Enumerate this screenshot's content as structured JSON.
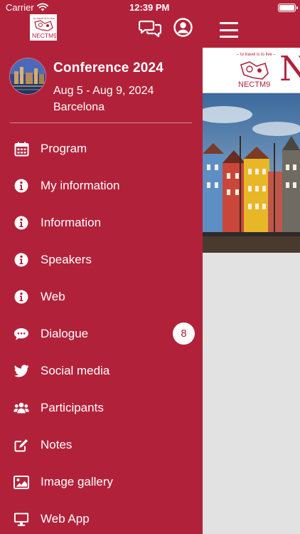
{
  "status_bar": {
    "carrier": "Carrier",
    "time": "12:39 PM"
  },
  "colors": {
    "brand": "#b1223a",
    "on_brand": "#ffffff"
  },
  "header": {
    "logo_text": "NECTM9",
    "logo_tagline": "to travel is to live",
    "chat_icon": "chat-bubbles-icon",
    "user_icon": "user-circle-icon"
  },
  "conference": {
    "title": "Conference 2024",
    "dates": "Aug 5 - Aug 9, 2024",
    "city": "Barcelona"
  },
  "menu": [
    {
      "label": "Program",
      "icon": "calendar-icon"
    },
    {
      "label": "My information",
      "icon": "info-icon"
    },
    {
      "label": "Information",
      "icon": "info-icon"
    },
    {
      "label": "Speakers",
      "icon": "info-icon"
    },
    {
      "label": "Web",
      "icon": "info-icon"
    },
    {
      "label": "Dialogue",
      "icon": "chat-icon",
      "badge": "8"
    },
    {
      "label": "Social media",
      "icon": "twitter-icon"
    },
    {
      "label": "Participants",
      "icon": "people-icon"
    },
    {
      "label": "Notes",
      "icon": "edit-icon"
    },
    {
      "label": "Image gallery",
      "icon": "image-icon"
    },
    {
      "label": "Web App",
      "icon": "monitor-icon"
    }
  ],
  "content": {
    "logo_text": "NECTM9",
    "logo_tagline": "– to travel is to live –",
    "title_initial": "N"
  }
}
